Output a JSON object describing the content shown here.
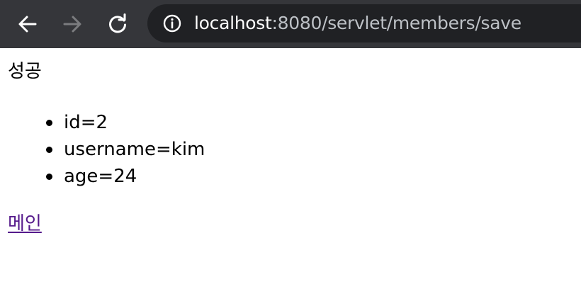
{
  "browser": {
    "url_host": "localhost",
    "url_path": ":8080/servlet/members/save",
    "colors": {
      "toolbar": "#35363a",
      "omnibox": "#202124",
      "host_text": "#ffffff",
      "path_text": "#bdc1c6",
      "icon_active": "#ffffff",
      "icon_disabled": "#7b7c7f"
    },
    "icons": [
      "back-arrow-icon",
      "forward-arrow-icon",
      "reload-icon",
      "info-icon"
    ]
  },
  "page": {
    "status": "성공",
    "members": [
      "id=2",
      "username=kim",
      "age=24"
    ],
    "main_link": "메인",
    "link_color": "#551a8b"
  }
}
